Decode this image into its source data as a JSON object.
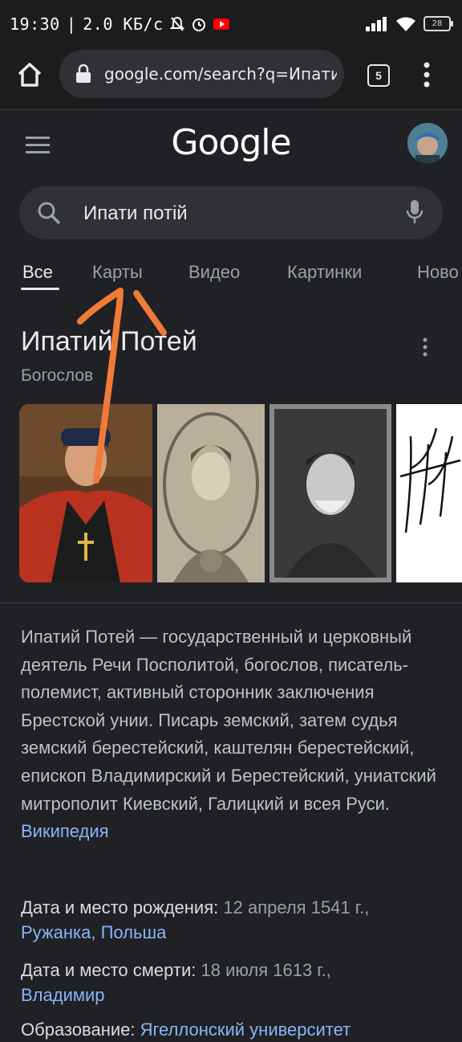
{
  "status_bar": {
    "time": "19:30",
    "speed": "2.0 КБ/с",
    "battery": "28"
  },
  "browser": {
    "url": "google.com/search?q=Ипати потій",
    "tab_count": "5"
  },
  "google": {
    "logo": "Google",
    "query": "Ипати потій"
  },
  "tabs": [
    {
      "label": "Все"
    },
    {
      "label": "Карты"
    },
    {
      "label": "Видео"
    },
    {
      "label": "Картинки"
    },
    {
      "label": "Ново"
    }
  ],
  "knowledge_panel": {
    "title": "Ипатий Потей",
    "subtitle": "Богослов",
    "description": "Ипатий Потей — государственный и церковный деятель Речи Посполитой, богослов, писатель-полемист, активный сторонник заключения Брестской унии. Писарь земский, затем судья земский берестейский, каштелян берестейский, епископ Владимирский и Берестейский, униатский митрополит Киевский, Галицкий и всея Руси.",
    "source_link": "Википедия",
    "facts": [
      {
        "label": "Дата и место рождения:",
        "value": "12 апреля 1541 г.,",
        "link": "Ружанка, Польша"
      },
      {
        "label": "Дата и место смерти:",
        "value": "18 июля 1613 г.,",
        "link": "Владимир"
      },
      {
        "label": "Образование:",
        "value": "",
        "link": "Ягеллонский университет"
      }
    ]
  },
  "colors": {
    "background": "#202124",
    "link": "#8ab4f8",
    "annotation": "#f07a3a"
  }
}
